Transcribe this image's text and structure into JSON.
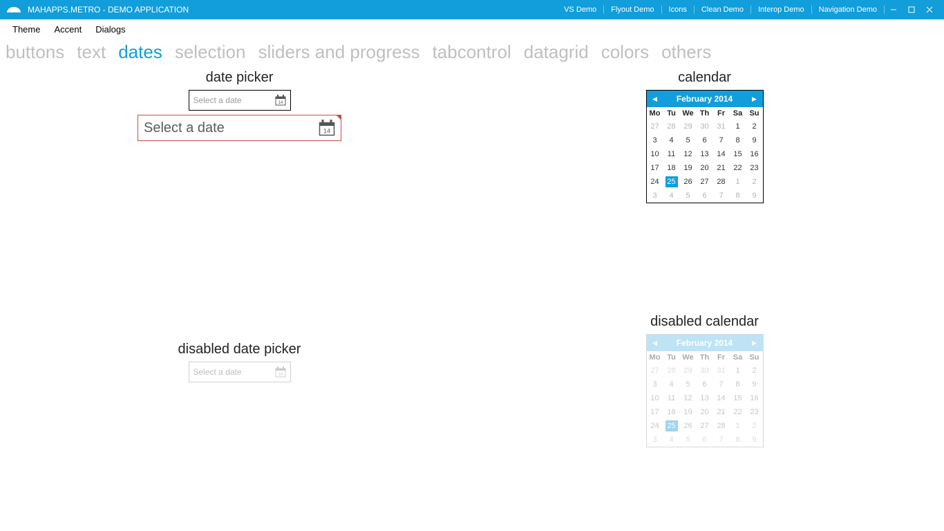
{
  "titlebar": {
    "app_title": "MAHAPPS.METRO - DEMO APPLICATION",
    "links": [
      "VS Demo",
      "Flyout Demo",
      "Icons",
      "Clean Demo",
      "Interop Demo",
      "Navigation Demo"
    ]
  },
  "menubar": {
    "items": [
      "Theme",
      "Accent",
      "Dialogs"
    ]
  },
  "tabs": {
    "items": [
      "buttons",
      "text",
      "dates",
      "selection",
      "sliders and progress",
      "tabcontrol",
      "datagrid",
      "colors",
      "others"
    ],
    "active_index": 2
  },
  "sections": {
    "date_picker_title": "date picker",
    "calendar_title": "calendar",
    "disabled_date_picker_title": "disabled date picker",
    "disabled_calendar_title": "disabled calendar"
  },
  "date_picker": {
    "small_placeholder": "Select a date",
    "large_placeholder": "Select a date",
    "disabled_placeholder": "Select a date"
  },
  "calendar": {
    "month_label": "February 2014",
    "weekdays": [
      "Mo",
      "Tu",
      "We",
      "Th",
      "Fr",
      "Sa",
      "Su"
    ],
    "weeks": [
      [
        {
          "d": 27,
          "oom": true
        },
        {
          "d": 28,
          "oom": true
        },
        {
          "d": 29,
          "oom": true
        },
        {
          "d": 30,
          "oom": true
        },
        {
          "d": 31,
          "oom": true
        },
        {
          "d": 1
        },
        {
          "d": 2
        }
      ],
      [
        {
          "d": 3
        },
        {
          "d": 4
        },
        {
          "d": 5
        },
        {
          "d": 6
        },
        {
          "d": 7
        },
        {
          "d": 8
        },
        {
          "d": 9
        }
      ],
      [
        {
          "d": 10
        },
        {
          "d": 11
        },
        {
          "d": 12
        },
        {
          "d": 13
        },
        {
          "d": 14
        },
        {
          "d": 15
        },
        {
          "d": 16
        }
      ],
      [
        {
          "d": 17
        },
        {
          "d": 18
        },
        {
          "d": 19
        },
        {
          "d": 20
        },
        {
          "d": 21
        },
        {
          "d": 22
        },
        {
          "d": 23
        }
      ],
      [
        {
          "d": 24
        },
        {
          "d": 25,
          "sel": true
        },
        {
          "d": 26
        },
        {
          "d": 27
        },
        {
          "d": 28
        },
        {
          "d": 1,
          "oom": true
        },
        {
          "d": 2,
          "oom": true
        }
      ],
      [
        {
          "d": 3,
          "oom": true
        },
        {
          "d": 4,
          "oom": true
        },
        {
          "d": 5,
          "oom": true
        },
        {
          "d": 6,
          "oom": true
        },
        {
          "d": 7,
          "oom": true
        },
        {
          "d": 8,
          "oom": true
        },
        {
          "d": 9,
          "oom": true
        }
      ]
    ]
  },
  "colors": {
    "accent": "#119eda",
    "error": "#c84b4b"
  }
}
